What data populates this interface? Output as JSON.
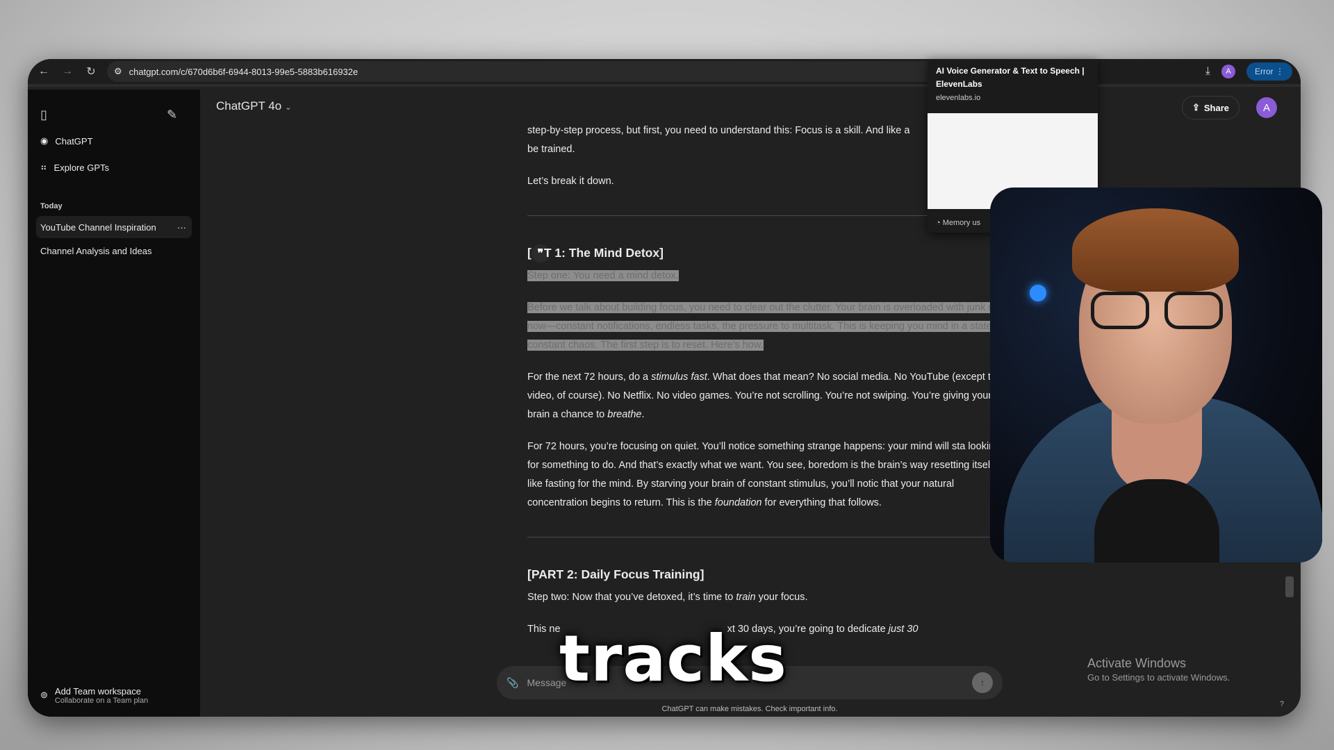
{
  "browser": {
    "url": "chatgpt.com/c/670d6b6f-6944-8013-99e5-5883b616932e",
    "profile_initial": "A",
    "error_label": "Error"
  },
  "tab_preview": {
    "title": "AI Voice Generator & Text to Speech | ElevenLabs",
    "domain": "elevenlabs.io",
    "memory": "Memory us"
  },
  "sidebar": {
    "items": [
      {
        "label": "ChatGPT"
      },
      {
        "label": "Explore GPTs"
      }
    ],
    "section": "Today",
    "chats": [
      {
        "label": "YouTube Channel Inspiration"
      },
      {
        "label": "Channel Analysis and Ideas"
      }
    ],
    "team": {
      "title": "Add Team workspace",
      "subtitle": "Collaborate on a Team plan"
    }
  },
  "header": {
    "model": "ChatGPT 4o",
    "share": "Share",
    "avatar": "A"
  },
  "content": {
    "p1": "step-by-step process, but first, you need to understand this: Focus is a skill. And like a",
    "p1b": "be trained.",
    "p2": "Let’s break it down.",
    "h1": "T 1: The Mind Detox]",
    "h1_prefix": "[",
    "step1": "Step one: You need a mind detox.",
    "p3": "Before we talk about building focus, you need to clear out the clutter. Your brain is overloaded with junk right now—constant notifications, endless tasks, the pressure to multitask. This is keeping you mind in a state of constant chaos. The first step is to reset. Here’s how.",
    "p4a": "For the next 72 hours, do a ",
    "p4i1": "stimulus fast",
    "p4b": ". What does that mean? No social media. No YouTube (except this video, of course). No Netflix. No video games. You’re not scrolling. You’re not swiping. You’re giving your brain a chance to ",
    "p4i2": "breathe",
    "p4c": ".",
    "p5a": "For 72 hours, you’re focusing on quiet. You’ll notice something strange happens: your mind will sta looking for something to do. And that’s exactly what we want. You see, boredom is the brain’s way resetting itself. It’s like fasting for the mind. By starving your brain of constant stimulus, you’ll notic that your natural concentration begins to return. This is the ",
    "p5i": "foundation",
    "p5b": " for everything that follows.",
    "h2": "[PART 2: Daily Focus Training]",
    "p6a": "Step two: Now that you’ve detoxed, it’s time to ",
    "p6i": "train",
    "p6b": " your focus.",
    "p7a": "This ne",
    "p7b": "xt 30 days, you’re going to dedicate ",
    "p7i": "just 30"
  },
  "composer": {
    "placeholder": "Message",
    "footer": "ChatGPT can make mistakes. Check important info."
  },
  "overlay": {
    "caption": "tracks",
    "activate_title": "Activate Windows",
    "activate_sub": "Go to Settings to activate Windows.",
    "help": "?"
  },
  "colors": {
    "sidebar": "#0d0d0d",
    "main": "#212121",
    "accent": "#8a5cd6",
    "error": "#0b4f8c"
  }
}
